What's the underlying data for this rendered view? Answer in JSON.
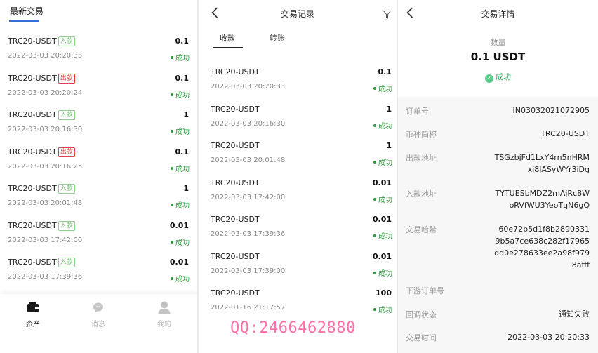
{
  "panel_list": {
    "tab_label": "最新交易",
    "items": [
      {
        "name": "TRC20-USDT",
        "tag": "入款",
        "tag_type": "in",
        "time": "2022-03-03 20:20:33",
        "amount": "0.1",
        "status": "成功"
      },
      {
        "name": "TRC20-USDT",
        "tag": "出款",
        "tag_type": "out",
        "time": "2022-03-03 20:20:24",
        "amount": "0.1",
        "status": "成功"
      },
      {
        "name": "TRC20-USDT",
        "tag": "入款",
        "tag_type": "in",
        "time": "2022-03-03 20:16:30",
        "amount": "1",
        "status": "成功"
      },
      {
        "name": "TRC20-USDT",
        "tag": "出款",
        "tag_type": "out",
        "time": "2022-03-03 20:16:25",
        "amount": "0.1",
        "status": "成功"
      },
      {
        "name": "TRC20-USDT",
        "tag": "入款",
        "tag_type": "in",
        "time": "2022-03-03 20:01:48",
        "amount": "1",
        "status": "成功"
      },
      {
        "name": "TRC20-USDT",
        "tag": "入款",
        "tag_type": "in",
        "time": "2022-03-03 17:42:00",
        "amount": "0.01",
        "status": "成功"
      },
      {
        "name": "TRC20-USDT",
        "tag": "入款",
        "tag_type": "in",
        "time": "2022-03-03 17:39:36",
        "amount": "0.01",
        "status": "成功"
      }
    ],
    "tabbar": [
      {
        "label": "资产",
        "icon": "wallet-icon",
        "active": true
      },
      {
        "label": "消息",
        "icon": "chat-bubble-icon",
        "active": false
      },
      {
        "label": "我的",
        "icon": "user-icon",
        "active": false
      }
    ]
  },
  "panel_records": {
    "title": "交易记录",
    "tabs": [
      {
        "label": "收款",
        "active": true
      },
      {
        "label": "转账",
        "active": false
      }
    ],
    "items": [
      {
        "name": "TRC20-USDT",
        "time": "2022-03-03 20:20:33",
        "amount": "0.1",
        "status": "成功"
      },
      {
        "name": "TRC20-USDT",
        "time": "2022-03-03 20:16:30",
        "amount": "1",
        "status": "成功"
      },
      {
        "name": "TRC20-USDT",
        "time": "2022-03-03 20:01:48",
        "amount": "1",
        "status": "成功"
      },
      {
        "name": "TRC20-USDT",
        "time": "2022-03-03 17:42:00",
        "amount": "0.01",
        "status": "成功"
      },
      {
        "name": "TRC20-USDT",
        "time": "2022-03-03 17:39:36",
        "amount": "0.01",
        "status": "成功"
      },
      {
        "name": "TRC20-USDT",
        "time": "2022-03-03 17:39:00",
        "amount": "0.01",
        "status": "成功"
      },
      {
        "name": "TRC20-USDT",
        "time": "2022-01-16 21:17:57",
        "amount": "100",
        "status": "成功"
      }
    ],
    "watermark": "QQ:2466462880"
  },
  "panel_detail": {
    "title": "交易详情",
    "quantity_label": "数量",
    "amount": "0.1 USDT",
    "status": "成功",
    "fields": [
      {
        "label": "订单号",
        "value": "IN03032021072905"
      },
      {
        "label": "币种简称",
        "value": "TRC20-USDT"
      },
      {
        "label": "出款地址",
        "value": "TSGzbjFd1LxY4rn5nHRMxj8JASyWYr3iDg"
      },
      {
        "label": "入款地址",
        "value": "TYTUESbMDZ2mAjRc8WoRVfWU3YeoTqN6gQ"
      },
      {
        "label": "交易哈希",
        "value": "60e72b5d1f8b28903319b5a7ce638c282f17965dd0e278633ee2a98f9798afff"
      },
      {
        "label": "下游订单号",
        "value": ""
      },
      {
        "label": "回调状态",
        "value": "通知失败"
      },
      {
        "label": "交易时间",
        "value": "2022-03-03 20:20:33"
      }
    ]
  },
  "colors": {
    "success": "#2a9a3a",
    "in_tag": "#7bbf7b",
    "out_tag": "#e04040",
    "tab_underline": "#2f6fde",
    "watermark": "#ff6fa8"
  }
}
